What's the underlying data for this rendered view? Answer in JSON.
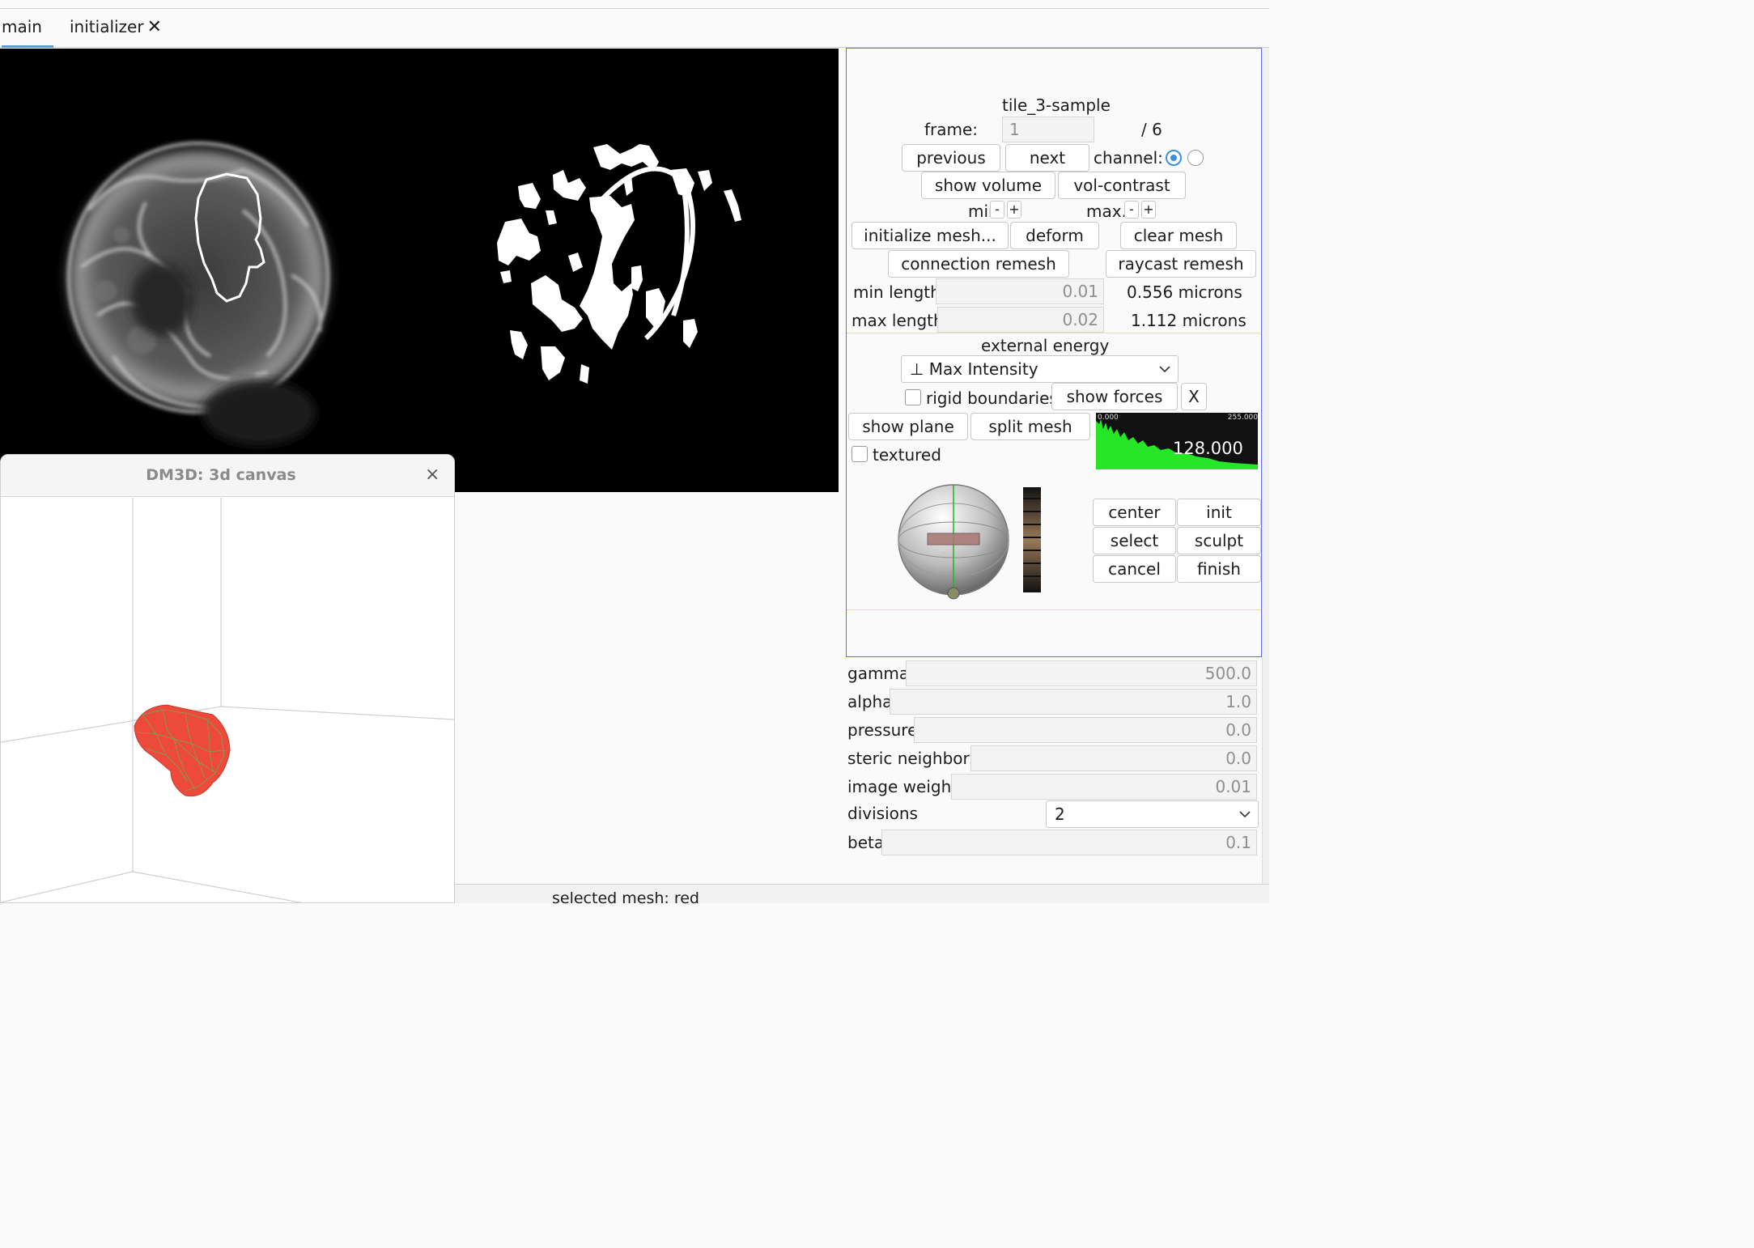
{
  "tabs": {
    "main": "main",
    "initializer": "initializer",
    "close_glyph": "✕"
  },
  "window3d": {
    "title": "DM3D: 3d canvas",
    "close_glyph": "×"
  },
  "panel": {
    "title": "tile_3-sample",
    "frame_label": "frame:",
    "frame_value": "1",
    "frame_total": "/ 6",
    "previous": "previous",
    "next": "next",
    "channel_label": "channel:",
    "show_volume": "show volume",
    "vol_contrast": "vol-contrast",
    "min_label": "min.",
    "max_label": "max.",
    "minus": "-",
    "plus": "+",
    "initialize_mesh": "initialize mesh...",
    "deform": "deform",
    "clear_mesh": "clear mesh",
    "connection_remesh": "connection remesh",
    "raycast_remesh": "raycast remesh",
    "min_length_label": "min length",
    "min_length_value": "0.01",
    "min_length_microns": "0.556 microns",
    "max_length_label": "max length",
    "max_length_value": "0.02",
    "max_length_microns": "1.112 microns",
    "external_energy_label": "external energy",
    "external_energy_value": "⊥ Max Intensity",
    "rigid_boundaries": "rigid boundaries",
    "show_forces": "show forces",
    "x_button": "X",
    "show_plane": "show plane",
    "split_mesh": "split mesh",
    "textured": "textured",
    "histogram_min": "0.000",
    "histogram_max": "255.000",
    "histogram_value": "128.000",
    "center": "center",
    "init": "init",
    "select": "select",
    "sculpt": "sculpt",
    "cancel": "cancel",
    "finish": "finish"
  },
  "params": [
    {
      "label": "gamma",
      "value": "500.0"
    },
    {
      "label": "alpha",
      "value": "1.0"
    },
    {
      "label": "pressure",
      "value": "0.0"
    },
    {
      "label": "steric neighbors",
      "value": "0.0"
    },
    {
      "label": "image weight",
      "value": "0.01"
    },
    {
      "label": "divisions",
      "value": "2"
    },
    {
      "label": "beta",
      "value": "0.1"
    }
  ],
  "status": {
    "text": "selected mesh:  red"
  },
  "colors": {
    "accent": "#3b8fe0",
    "histogram": "#27e627",
    "mesh": "#f0493c",
    "mesh_wire": "#4aa34a",
    "panel_border": "#6a6ad8"
  },
  "icons": {
    "chevron": "chevron-down-icon",
    "close": "close-icon"
  }
}
